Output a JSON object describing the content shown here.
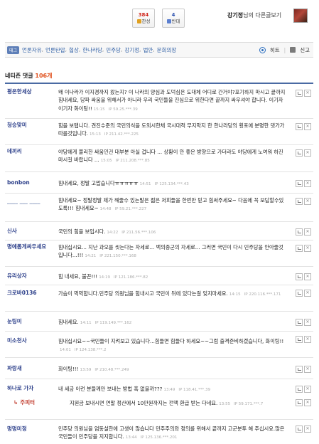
{
  "vote": {
    "up_count": "384",
    "up_label": "찬성",
    "down_count": "4",
    "down_label": "반대"
  },
  "author": {
    "name": "강기정",
    "suffix": "님의 다른글보기"
  },
  "tags": {
    "badge": "태그",
    "items": [
      "언론자유",
      "언론탄압",
      "협상",
      "한나라당",
      "민주당",
      "강기정",
      "법안",
      "문희의장"
    ],
    "hint_label": "히트",
    "report_label": "신고"
  },
  "comments_header": {
    "label": "네티즌 댓글",
    "count": "106개"
  },
  "comments": [
    {
      "nick": "평온한세상",
      "text": "왜 이나라가 이지경까지 왔는지? 이 나라의 양심과 도덕심은 도대체 어디로 간거야?포기하지 마시고 끝까지 힘내세요, 당파 싸움을 위해서가 아니라 우리 국민들을 진심으로 위한다면 끝까지 싸우셔야 합니다. 이기자 이기자 화이팅!!",
      "time": "15:15",
      "ip": "IP 59.25.***.39"
    },
    {
      "nick": "청승맞미",
      "text": "힘을 보탭니다. 견진수준의 국민의식을 도외시한채 국시대적 무지막지 한 한나라당의 횡포에 분명한 댓가가 따를것입니다.",
      "time": "15:13",
      "ip": "IP 211.42.***.225"
    },
    {
      "nick": "데끼리",
      "text": "야당에게 불리한 싸움인건 대부분 아실 겁니다 ... 상황이 안 좋은 방향으로 가더라도 야당에게 노여워 하진 마시길 바랍니다 ...",
      "time": "15:05",
      "ip": "IP 211.208.***.85"
    },
    {
      "nick": "bonbon",
      "text": "힘내세요, 정말 고맙습니다ㅠㅠㅠㅠㅠ",
      "time": "14:51",
      "ip": "IP 125.134.***.43"
    },
    {
      "nick": "____ ___ ____",
      "text": "힘내세요~ 정말정말 제가 해줄수 있는말은 젊은 저희들을 한번만 믿고 힘써주세요~ 다음에 꼭 보답할수있도록!!! 힘내세요~",
      "time": "14:48",
      "ip": "IP 59.21.***.227"
    },
    {
      "nick": "신사",
      "text": "국민의 힘을 보입시다.",
      "time": "14:22",
      "ip": "IP 211.56.***.106"
    },
    {
      "nick": "명예롭게싸우세요",
      "text": "힘내십시요... 지난 과오를 씻는다는 자세로... 백의종군의 자세로... 그러면 국민이 다시 민주당을 안아줄것입니다...!!!",
      "time": "14:21",
      "ip": "IP 221.150.***.168"
    },
    {
      "nick": "유리상자",
      "text": "힘 내세요, 불끈!!!",
      "time": "14:19",
      "ip": "IP 121.186.***.82"
    },
    {
      "nick": "크로바0136",
      "text": "가슴이 먹먹합니다.민주당 의원님을 힘내시고 국민이 뒤에 있다는걸 잊지마세요.",
      "time": "14:15",
      "ip": "IP 220.116.***.171"
    },
    {
      "nick": "눈팅미",
      "text": "힘내세요.",
      "time": "14:11",
      "ip": "IP 119.149.***.162"
    },
    {
      "nick": "미소천사",
      "text": "힘내십시요~~국민들이 지켜보고 있습니다...힘들면 힘들다 하세요~~그럼 출격준비하겠습니다, 화이팅!!",
      "time": "14:01",
      "ip": "IP 124.138.***.2"
    },
    {
      "nick": "파랑새",
      "text": "화이팅!!!",
      "time": "13:59",
      "ip": "IP 210.48.***.249"
    },
    {
      "nick": "하나로 가자",
      "text": "내 세금 이런 분들께만 보내는 방법 혹 없을까???",
      "time": "13:49",
      "ip": "IP 118.41.***.39"
    },
    {
      "nick": "주피터",
      "text": "지원금 보내시면 연말 정산에서 10만원까지는 전액 환급 받는 다네요.",
      "time": "13:55",
      "ip": "IP 59.171.***.7"
    },
    {
      "nick": "멍멍미정",
      "text": "민주당 의원님을 엄동설한에 고생이 많습니다 민주주의와 정의를 위해서 끝까지 고군분투 해 주십시요.많은 국민들이 민주당을 지지합니다.",
      "time": "13:44",
      "ip": "IP 125.136.***.201"
    }
  ]
}
